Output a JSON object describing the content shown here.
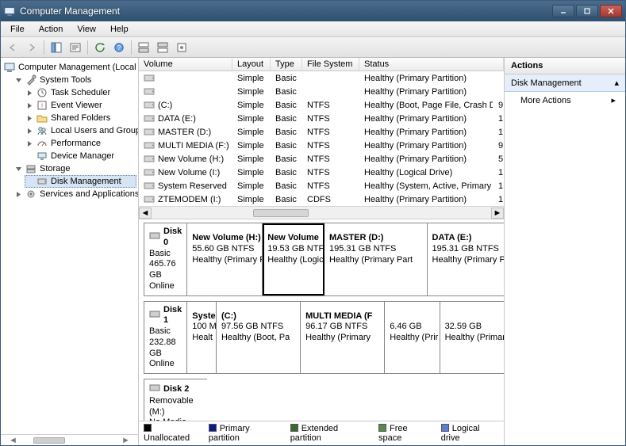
{
  "window": {
    "title": "Computer Management"
  },
  "menubar": [
    "File",
    "Action",
    "View",
    "Help"
  ],
  "tree": {
    "root": "Computer Management (Local",
    "system_tools": {
      "label": "System Tools",
      "children": [
        "Task Scheduler",
        "Event Viewer",
        "Shared Folders",
        "Local Users and Groups",
        "Performance",
        "Device Manager"
      ]
    },
    "storage": {
      "label": "Storage",
      "children": [
        "Disk Management"
      ],
      "selected": "Disk Management"
    },
    "services": {
      "label": "Services and Applications"
    }
  },
  "columns": [
    "Volume",
    "Layout",
    "Type",
    "File System",
    "Status"
  ],
  "volumes": [
    {
      "name": "",
      "layout": "Simple",
      "type": "Basic",
      "fs": "",
      "status": "Healthy (Primary Partition)",
      "tail": ""
    },
    {
      "name": "",
      "layout": "Simple",
      "type": "Basic",
      "fs": "",
      "status": "Healthy (Primary Partition)",
      "tail": ""
    },
    {
      "name": "(C:)",
      "layout": "Simple",
      "type": "Basic",
      "fs": "NTFS",
      "status": "Healthy (Boot, Page File, Crash Dump, Primary Partition)",
      "tail": "9"
    },
    {
      "name": "DATA (E:)",
      "layout": "Simple",
      "type": "Basic",
      "fs": "NTFS",
      "status": "Healthy (Primary Partition)",
      "tail": "1"
    },
    {
      "name": "MASTER (D:)",
      "layout": "Simple",
      "type": "Basic",
      "fs": "NTFS",
      "status": "Healthy (Primary Partition)",
      "tail": "1"
    },
    {
      "name": "MULTI MEDIA (F:)",
      "layout": "Simple",
      "type": "Basic",
      "fs": "NTFS",
      "status": "Healthy (Primary Partition)",
      "tail": "9"
    },
    {
      "name": "New Volume (H:)",
      "layout": "Simple",
      "type": "Basic",
      "fs": "NTFS",
      "status": "Healthy (Primary Partition)",
      "tail": "5"
    },
    {
      "name": "New Volume (I:)",
      "layout": "Simple",
      "type": "Basic",
      "fs": "NTFS",
      "status": "Healthy (Logical Drive)",
      "tail": "1"
    },
    {
      "name": "System Reserved",
      "layout": "Simple",
      "type": "Basic",
      "fs": "NTFS",
      "status": "Healthy (System, Active, Primary Partition)",
      "tail": "1"
    },
    {
      "name": "ZTEMODEM (I:)",
      "layout": "Simple",
      "type": "Basic",
      "fs": "CDFS",
      "status": "Healthy (Primary Partition)",
      "tail": "1"
    }
  ],
  "disks": [
    {
      "name": "Disk 0",
      "type": "Basic",
      "size": "465.76 GB",
      "status": "Online",
      "parts": [
        {
          "title": "New Volume  (H:)",
          "line2": "55.60 GB NTFS",
          "line3": "Healthy (Primary P",
          "w": 22
        },
        {
          "title": "New Volume",
          "line2": "19.53 GB NTFS",
          "line3": "Healthy (Logic",
          "w": 18,
          "selected": true
        },
        {
          "title": "MASTER  (D:)",
          "line2": "195.31 GB NTFS",
          "line3": "Healthy (Primary Part",
          "w": 30
        },
        {
          "title": "DATA  (E:)",
          "line2": "195.31 GB NTFS",
          "line3": "Healthy (Primary Part",
          "w": 30
        }
      ]
    },
    {
      "name": "Disk 1",
      "type": "Basic",
      "size": "232.88 GB",
      "status": "Online",
      "parts": [
        {
          "title": "Syste",
          "line2": "100 M",
          "line3": "Healt",
          "w": 9
        },
        {
          "title": "(C:)",
          "line2": "97.56 GB NTFS",
          "line3": "Healthy (Boot, Pa",
          "w": 26
        },
        {
          "title": "MULTI MEDIA  (F",
          "line2": "96.17 GB NTFS",
          "line3": "Healthy (Primary",
          "w": 26
        },
        {
          "title": "",
          "line2": "6.46 GB",
          "line3": "Healthy (Prir",
          "w": 17
        },
        {
          "title": "",
          "line2": "32.59 GB",
          "line3": "Healthy (Primary",
          "w": 22
        }
      ]
    },
    {
      "name": "Disk 2",
      "type": "Removable (M:)",
      "size": "",
      "status": "No Media",
      "nomedia": true,
      "parts": []
    }
  ],
  "legend": [
    {
      "label": "Unallocated",
      "color": "#000000"
    },
    {
      "label": "Primary partition",
      "color": "#0b1b8a"
    },
    {
      "label": "Extended partition",
      "color": "#3a6a2e"
    },
    {
      "label": "Free space",
      "color": "#5a8a4a"
    },
    {
      "label": "Logical drive",
      "color": "#5a7ed6"
    }
  ],
  "actions": {
    "header": "Actions",
    "group": "Disk Management",
    "items": [
      "More Actions"
    ]
  }
}
